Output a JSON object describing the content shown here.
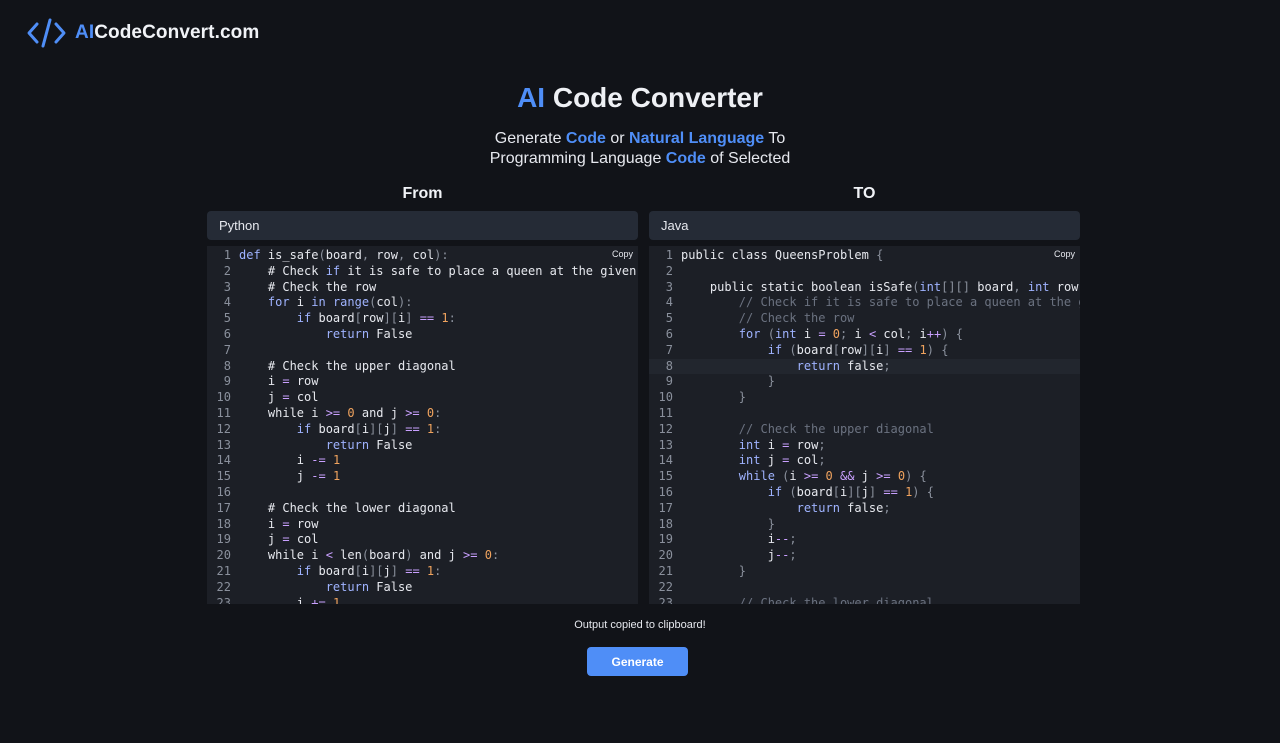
{
  "logo": {
    "prefix": "AI",
    "rest": "CodeConvert.com"
  },
  "hero": {
    "title_prefix": "AI",
    "title_rest": " Code Converter",
    "sub_1": "Generate ",
    "sub_code_1": "Code",
    "sub_2": " or ",
    "sub_natural": "Natural Language",
    "sub_3": " To",
    "sub_4": "Programming Language ",
    "sub_code_2": "Code",
    "sub_5": " of Selected"
  },
  "from": {
    "heading": "From",
    "language": "Python",
    "copy_label": "Copy"
  },
  "to": {
    "heading": "TO",
    "language": "Java",
    "copy_label": "Copy"
  },
  "status_text": "Output copied to clipboard!",
  "generate_label": "Generate",
  "colors": {
    "accent": "#4f8ef7",
    "background": "#111318",
    "editor": "#1c1f26",
    "select": "#252b36"
  },
  "source_code": [
    [
      [
        "kw",
        "def"
      ],
      [
        "t",
        " is_safe"
      ],
      [
        "punc",
        "("
      ],
      [
        "t",
        "board"
      ],
      [
        "punc",
        ","
      ],
      [
        "t",
        " row"
      ],
      [
        "punc",
        ","
      ],
      [
        "t",
        " col"
      ],
      [
        "punc",
        "):"
      ]
    ],
    [
      [
        "t",
        "    # Check "
      ],
      [
        "kw",
        "if"
      ],
      [
        "t",
        " it is safe to place a queen at the given po"
      ]
    ],
    [
      [
        "t",
        "    # Check the row"
      ]
    ],
    [
      [
        "kw",
        "    for"
      ],
      [
        "t",
        " i "
      ],
      [
        "kw",
        "in"
      ],
      [
        "t",
        " "
      ],
      [
        "kw",
        "range"
      ],
      [
        "punc",
        "("
      ],
      [
        "t",
        "col"
      ],
      [
        "punc",
        "):"
      ]
    ],
    [
      [
        "kw",
        "        if"
      ],
      [
        "t",
        " board"
      ],
      [
        "punc",
        "["
      ],
      [
        "t",
        "row"
      ],
      [
        "punc",
        "]["
      ],
      [
        "t",
        "i"
      ],
      [
        "punc",
        "]"
      ],
      [
        "t",
        " "
      ],
      [
        "op",
        "=="
      ],
      [
        "t",
        " "
      ],
      [
        "num",
        "1"
      ],
      [
        "punc",
        ":"
      ]
    ],
    [
      [
        "kw",
        "            return"
      ],
      [
        "t",
        " False"
      ]
    ],
    [
      [
        "t",
        ""
      ]
    ],
    [
      [
        "t",
        "    # Check the upper diagonal"
      ]
    ],
    [
      [
        "t",
        "    i "
      ],
      [
        "op",
        "="
      ],
      [
        "t",
        " row"
      ]
    ],
    [
      [
        "t",
        "    j "
      ],
      [
        "op",
        "="
      ],
      [
        "t",
        " col"
      ]
    ],
    [
      [
        "t",
        "    while i "
      ],
      [
        "op",
        ">="
      ],
      [
        "t",
        " "
      ],
      [
        "num",
        "0"
      ],
      [
        "t",
        " and j "
      ],
      [
        "op",
        ">="
      ],
      [
        "t",
        " "
      ],
      [
        "num",
        "0"
      ],
      [
        "punc",
        ":"
      ]
    ],
    [
      [
        "kw",
        "        if"
      ],
      [
        "t",
        " board"
      ],
      [
        "punc",
        "["
      ],
      [
        "t",
        "i"
      ],
      [
        "punc",
        "]["
      ],
      [
        "t",
        "j"
      ],
      [
        "punc",
        "]"
      ],
      [
        "t",
        " "
      ],
      [
        "op",
        "=="
      ],
      [
        "t",
        " "
      ],
      [
        "num",
        "1"
      ],
      [
        "punc",
        ":"
      ]
    ],
    [
      [
        "kw",
        "            return"
      ],
      [
        "t",
        " False"
      ]
    ],
    [
      [
        "t",
        "        i "
      ],
      [
        "op",
        "-="
      ],
      [
        "t",
        " "
      ],
      [
        "num",
        "1"
      ]
    ],
    [
      [
        "t",
        "        j "
      ],
      [
        "op",
        "-="
      ],
      [
        "t",
        " "
      ],
      [
        "num",
        "1"
      ]
    ],
    [
      [
        "t",
        ""
      ]
    ],
    [
      [
        "t",
        "    # Check the lower diagonal"
      ]
    ],
    [
      [
        "t",
        "    i "
      ],
      [
        "op",
        "="
      ],
      [
        "t",
        " row"
      ]
    ],
    [
      [
        "t",
        "    j "
      ],
      [
        "op",
        "="
      ],
      [
        "t",
        " col"
      ]
    ],
    [
      [
        "t",
        "    while i "
      ],
      [
        "op",
        "<"
      ],
      [
        "t",
        " len"
      ],
      [
        "punc",
        "("
      ],
      [
        "t",
        "board"
      ],
      [
        "punc",
        ")"
      ],
      [
        "t",
        " and j "
      ],
      [
        "op",
        ">="
      ],
      [
        "t",
        " "
      ],
      [
        "num",
        "0"
      ],
      [
        "punc",
        ":"
      ]
    ],
    [
      [
        "kw",
        "        if"
      ],
      [
        "t",
        " board"
      ],
      [
        "punc",
        "["
      ],
      [
        "t",
        "i"
      ],
      [
        "punc",
        "]["
      ],
      [
        "t",
        "j"
      ],
      [
        "punc",
        "]"
      ],
      [
        "t",
        " "
      ],
      [
        "op",
        "=="
      ],
      [
        "t",
        " "
      ],
      [
        "num",
        "1"
      ],
      [
        "punc",
        ":"
      ]
    ],
    [
      [
        "kw",
        "            return"
      ],
      [
        "t",
        " False"
      ]
    ],
    [
      [
        "t",
        "        i "
      ],
      [
        "op",
        "+="
      ],
      [
        "t",
        " "
      ],
      [
        "num",
        "1"
      ]
    ]
  ],
  "target_code": [
    [
      [
        "t",
        "public class QueensProblem "
      ],
      [
        "punc",
        "{"
      ]
    ],
    [
      [
        "t",
        ""
      ]
    ],
    [
      [
        "t",
        "    public static boolean isSafe"
      ],
      [
        "punc",
        "("
      ],
      [
        "kw",
        "int"
      ],
      [
        "punc",
        "[][]"
      ],
      [
        "t",
        " board"
      ],
      [
        "punc",
        ","
      ],
      [
        "t",
        " "
      ],
      [
        "kw",
        "int"
      ],
      [
        "t",
        " row"
      ],
      [
        "punc",
        ","
      ],
      [
        "t",
        " i"
      ]
    ],
    [
      [
        "cm",
        "        // Check if it is safe to place a queen at the giv"
      ]
    ],
    [
      [
        "cm",
        "        // Check the row"
      ]
    ],
    [
      [
        "kw",
        "        for"
      ],
      [
        "t",
        " "
      ],
      [
        "punc",
        "("
      ],
      [
        "kw",
        "int"
      ],
      [
        "t",
        " i "
      ],
      [
        "op",
        "="
      ],
      [
        "t",
        " "
      ],
      [
        "num",
        "0"
      ],
      [
        "punc",
        ";"
      ],
      [
        "t",
        " i "
      ],
      [
        "op",
        "<"
      ],
      [
        "t",
        " col"
      ],
      [
        "punc",
        ";"
      ],
      [
        "t",
        " i"
      ],
      [
        "op",
        "++"
      ],
      [
        "punc",
        ")"
      ],
      [
        "t",
        " "
      ],
      [
        "punc",
        "{"
      ]
    ],
    [
      [
        "kw",
        "            if"
      ],
      [
        "t",
        " "
      ],
      [
        "punc",
        "("
      ],
      [
        "t",
        "board"
      ],
      [
        "punc",
        "["
      ],
      [
        "t",
        "row"
      ],
      [
        "punc",
        "]["
      ],
      [
        "t",
        "i"
      ],
      [
        "punc",
        "]"
      ],
      [
        "t",
        " "
      ],
      [
        "op",
        "=="
      ],
      [
        "t",
        " "
      ],
      [
        "num",
        "1"
      ],
      [
        "punc",
        ")"
      ],
      [
        "t",
        " "
      ],
      [
        "punc",
        "{"
      ]
    ],
    [
      [
        "kw",
        "                return"
      ],
      [
        "t",
        " false"
      ],
      [
        "punc",
        ";"
      ]
    ],
    [
      [
        "punc",
        "            }"
      ]
    ],
    [
      [
        "punc",
        "        }"
      ]
    ],
    [
      [
        "t",
        ""
      ]
    ],
    [
      [
        "cm",
        "        // Check the upper diagonal"
      ]
    ],
    [
      [
        "kw",
        "        int"
      ],
      [
        "t",
        " i "
      ],
      [
        "op",
        "="
      ],
      [
        "t",
        " row"
      ],
      [
        "punc",
        ";"
      ]
    ],
    [
      [
        "kw",
        "        int"
      ],
      [
        "t",
        " j "
      ],
      [
        "op",
        "="
      ],
      [
        "t",
        " col"
      ],
      [
        "punc",
        ";"
      ]
    ],
    [
      [
        "kw",
        "        while"
      ],
      [
        "t",
        " "
      ],
      [
        "punc",
        "("
      ],
      [
        "t",
        "i "
      ],
      [
        "op",
        ">="
      ],
      [
        "t",
        " "
      ],
      [
        "num",
        "0"
      ],
      [
        "t",
        " "
      ],
      [
        "op",
        "&&"
      ],
      [
        "t",
        " j "
      ],
      [
        "op",
        ">="
      ],
      [
        "t",
        " "
      ],
      [
        "num",
        "0"
      ],
      [
        "punc",
        ")"
      ],
      [
        "t",
        " "
      ],
      [
        "punc",
        "{"
      ]
    ],
    [
      [
        "kw",
        "            if"
      ],
      [
        "t",
        " "
      ],
      [
        "punc",
        "("
      ],
      [
        "t",
        "board"
      ],
      [
        "punc",
        "["
      ],
      [
        "t",
        "i"
      ],
      [
        "punc",
        "]["
      ],
      [
        "t",
        "j"
      ],
      [
        "punc",
        "]"
      ],
      [
        "t",
        " "
      ],
      [
        "op",
        "=="
      ],
      [
        "t",
        " "
      ],
      [
        "num",
        "1"
      ],
      [
        "punc",
        ")"
      ],
      [
        "t",
        " "
      ],
      [
        "punc",
        "{"
      ]
    ],
    [
      [
        "kw",
        "                return"
      ],
      [
        "t",
        " false"
      ],
      [
        "punc",
        ";"
      ]
    ],
    [
      [
        "punc",
        "            }"
      ]
    ],
    [
      [
        "t",
        "            i"
      ],
      [
        "op",
        "--"
      ],
      [
        "punc",
        ";"
      ]
    ],
    [
      [
        "t",
        "            j"
      ],
      [
        "op",
        "--"
      ],
      [
        "punc",
        ";"
      ]
    ],
    [
      [
        "punc",
        "        }"
      ]
    ],
    [
      [
        "t",
        ""
      ]
    ],
    [
      [
        "cm",
        "        // Check the lower diagonal"
      ]
    ]
  ]
}
